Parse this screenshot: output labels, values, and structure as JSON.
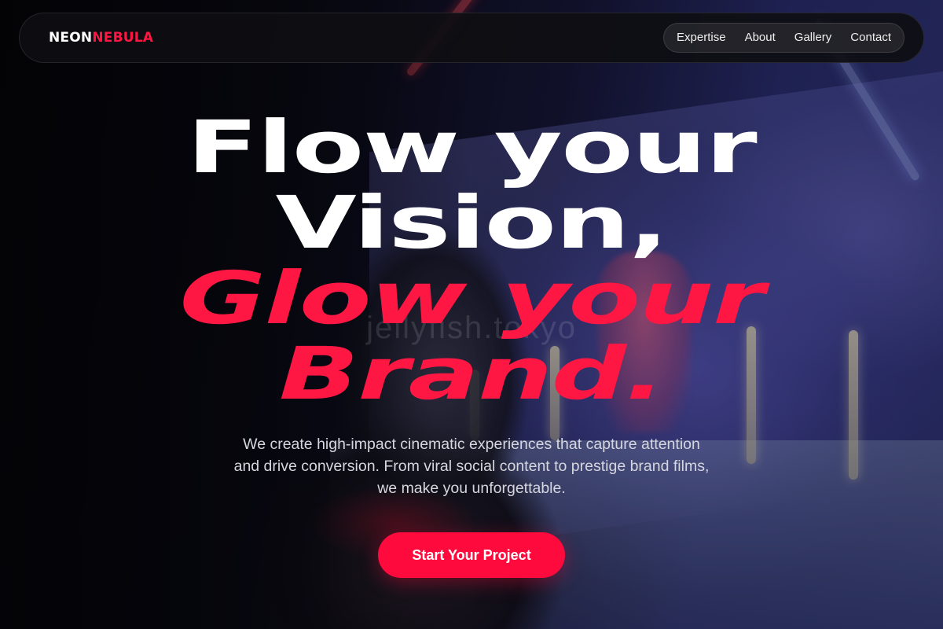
{
  "brand": {
    "part1": "NEON",
    "part2": "NEBULA"
  },
  "nav": {
    "items": [
      {
        "label": "Expertise"
      },
      {
        "label": "About"
      },
      {
        "label": "Gallery"
      },
      {
        "label": "Contact"
      }
    ]
  },
  "hero": {
    "line1": "Flow your",
    "line2": "Vision,",
    "line3": "Glow your",
    "line4": "Brand.",
    "subtext_line1": "We create high-impact cinematic experiences that capture attention",
    "subtext_line2": "and drive conversion. From viral social content to prestige brand films,",
    "subtext_line3": "we make you unforgettable.",
    "cta_label": "Start Your Project",
    "watermark": "jellyfish.tokyo"
  },
  "colors": {
    "accent": "#ff1744",
    "button": "#ff0a3c",
    "navbar": "#0e0e12"
  }
}
